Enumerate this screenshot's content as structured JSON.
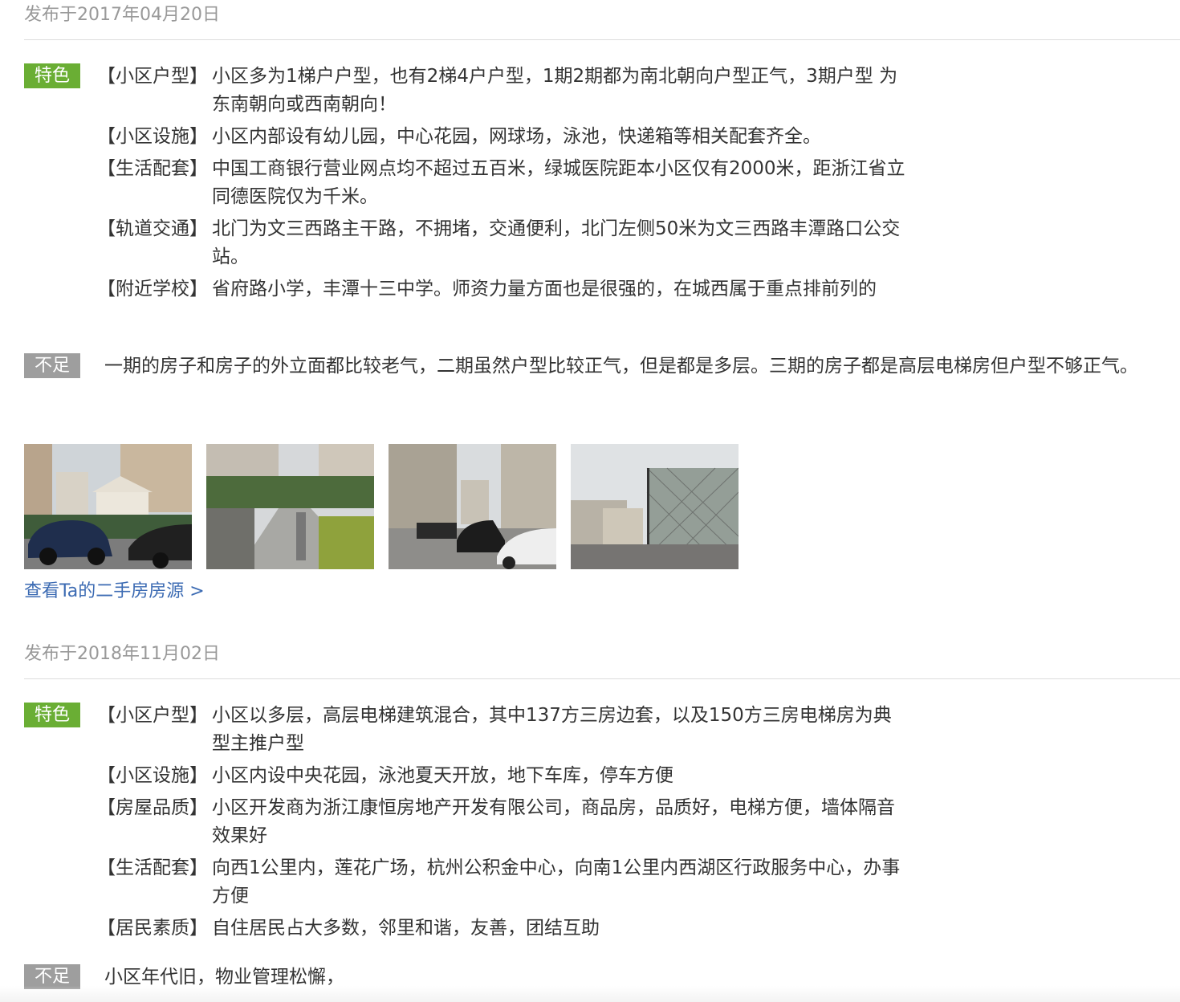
{
  "reviews": [
    {
      "date": "发布于2017年04月20日",
      "good_tag": "特色",
      "features": [
        {
          "label": "【小区户型】",
          "text": "小区多为1梯户户型，也有2梯4户户型，1期2期都为南北朝向户型正气，3期户型 为东南朝向或西南朝向！"
        },
        {
          "label": "【小区设施】",
          "text": "小区内部设有幼儿园，中心花园，网球场，泳池，快递箱等相关配套齐全。"
        },
        {
          "label": "【生活配套】",
          "text": "中国工商银行营业网点均不超过五百米，绿城医院距本小区仅有2000米，距浙江省立同德医院仅为千米。"
        },
        {
          "label": "【轨道交通】",
          "text": "北门为文三西路主干路，不拥堵，交通便利，北门左侧50米为文三西路丰潭路口公交站。"
        },
        {
          "label": "【附近学校】",
          "text": "省府路小学，丰潭十三中学。师资力量方面也是很强的，在城西属于重点排前列的"
        }
      ],
      "bad_tag": "不足",
      "weakness": "一期的房子和房子的外立面都比较老气，二期虽然户型比较正气，但是都是多层。三期的房子都是高层电梯房但户型不够正气。",
      "link": "查看Ta的二手房房源 >"
    },
    {
      "date": "发布于2018年11月02日",
      "good_tag": "特色",
      "features": [
        {
          "label": "【小区户型】",
          "text": "小区以多层，高层电梯建筑混合，其中137方三房边套，以及150方三房电梯房为典型主推户型"
        },
        {
          "label": "【小区设施】",
          "text": "小区内设中央花园，泳池夏天开放，地下车库，停车方便"
        },
        {
          "label": "【房屋品质】",
          "text": "小区开发商为浙江康恒房地产开发有限公司，商品房，品质好，电梯方便，墙体隔音效果好"
        },
        {
          "label": "【生活配套】",
          "text": "向西1公里内，莲花广场，杭州公积金中心，向南1公里内西湖区行政服务中心，办事方便"
        },
        {
          "label": "【居民素质】",
          "text": "自住居民占大多数，邻里和谐，友善，团结互助"
        }
      ],
      "bad_tag": "不足",
      "weakness": "小区年代旧，物业管理松懈，"
    }
  ],
  "colors": {
    "good_tag": "#6aae34",
    "bad_tag": "#9e9e9e",
    "link": "#3c6bb3",
    "date": "#999999"
  }
}
